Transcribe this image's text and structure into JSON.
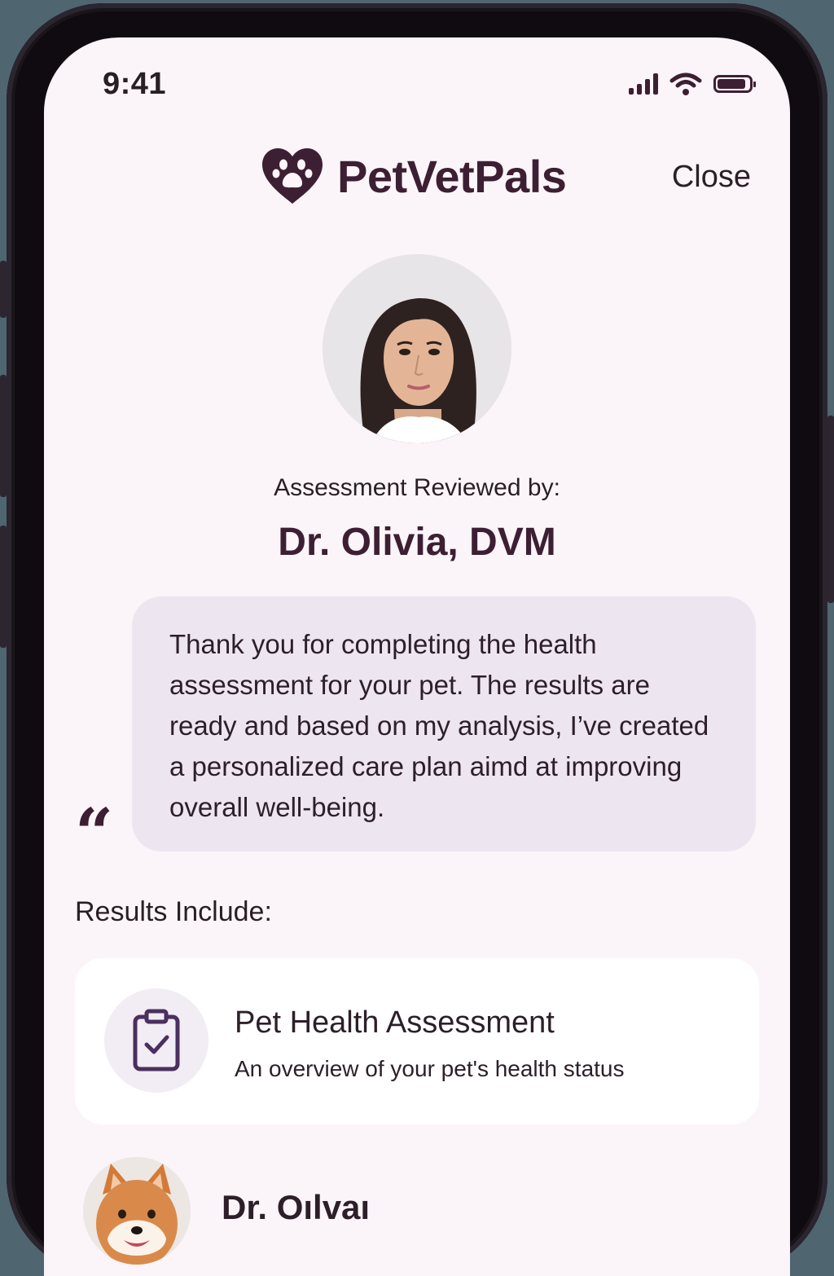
{
  "status_bar": {
    "time": "9:41",
    "battery_level": 0.9
  },
  "header": {
    "app_name": "PetVetPals",
    "close_label": "Close"
  },
  "reviewer": {
    "label": "Assessment Reviewed by:",
    "name": "Dr. Olivia, DVM"
  },
  "message": {
    "quote_glyph": "“",
    "text": "Thank you for completing the health assessment for your pet. The results are ready and based on my analysis, I’ve created a personalized care plan aimd at improving overall well-being."
  },
  "results": {
    "heading": "Results Include:",
    "items": [
      {
        "title": "Pet Health Assessment",
        "subtitle": "An overview of your pet's health status",
        "icon": "clipboard-check-icon"
      }
    ]
  },
  "pet_entry": {
    "name": "Dr. Oılvaı"
  },
  "colors": {
    "brand": "#3d1f33",
    "background": "#fbf5fa",
    "bubble": "#ede5f0",
    "icon_accent": "#4a2f5f"
  }
}
